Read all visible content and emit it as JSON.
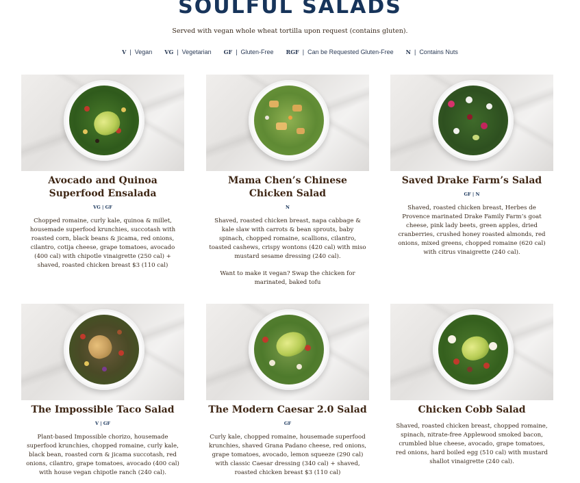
{
  "header": {
    "title": "SOULFUL SALADS",
    "subtitle": "Served with vegan whole wheat tortilla upon request (contains gluten)."
  },
  "legend": [
    {
      "code": "V",
      "label": "Vegan"
    },
    {
      "code": "VG",
      "label": "Vegetarian"
    },
    {
      "code": "GF",
      "label": "Gluten-Free"
    },
    {
      "code": "RGF",
      "label": "Can be Requested Gluten-Free"
    },
    {
      "code": "N",
      "label": "Contains Nuts"
    }
  ],
  "salads": [
    {
      "name": "Avocado and Quinoa Superfood Ensalada",
      "tags": "VG | GF",
      "description": "Chopped romaine, curly kale, quinoa & millet, housemade superfood krunchies, succotash with roasted corn, black beans & jicama, red onions, cilantro, cotija cheese, grape tomatoes, avocado (400 cal) with chipotle vinaigrette (250 cal) + shaved, roasted chicken breast $3 (110 cal)",
      "note": ""
    },
    {
      "name": "Mama Chen’s Chinese Chicken Salad",
      "tags": "N",
      "description": "Shaved, roasted chicken breast, napa cabbage & kale slaw with carrots & bean sprouts, baby spinach, chopped romaine, scallions, cilantro, toasted cashews, crispy wontons (420 cal) with miso mustard sesame dressing (240 cal).",
      "note": "Want to make it vegan? Swap the chicken for marinated, baked tofu"
    },
    {
      "name": "Saved Drake Farm’s Salad",
      "tags": "GF | N",
      "description": "Shaved, roasted chicken breast, Herbes de Provence marinated Drake Family Farm’s goat cheese, pink lady beets, green apples, dried cranberries, crushed honey roasted almonds, red onions, mixed greens, chopped romaine (620 cal) with citrus vinaigrette (240 cal).",
      "note": ""
    },
    {
      "name": "The Impossible Taco Salad",
      "tags": "V | GF",
      "description": "Plant-based Impossible chorizo, housemade superfood krunchies, chopped romaine, curly kale, black bean, roasted corn & jicama succotash, red onions, cilantro, grape tomatoes, avocado (400 cal) with house vegan chipotle ranch (240 cal).",
      "note": ""
    },
    {
      "name": "The Modern Caesar 2.0 Salad",
      "tags": "GF",
      "description": "Curly kale, chopped romaine, housemade superfood krunchies, shaved Grana Padano cheese, red onions, grape tomatoes, avocado, lemon squeeze (290 cal) with classic Caesar dressing (340 cal) + shaved, roasted chicken breast $3 (110 cal)",
      "note": ""
    },
    {
      "name": "Chicken Cobb Salad",
      "tags": "",
      "description": "Shaved, roasted chicken breast, chopped romaine, spinach, nitrate-free Applewood smoked bacon, crumbled blue cheese, avocado, grape tomatoes, red onions, hard boiled egg (510 cal) with mustard shallot vinaigrette (240 cal).",
      "note": ""
    }
  ],
  "colors": {
    "title": "#17345a",
    "name": "#3e2614",
    "tags": "#17345a"
  }
}
